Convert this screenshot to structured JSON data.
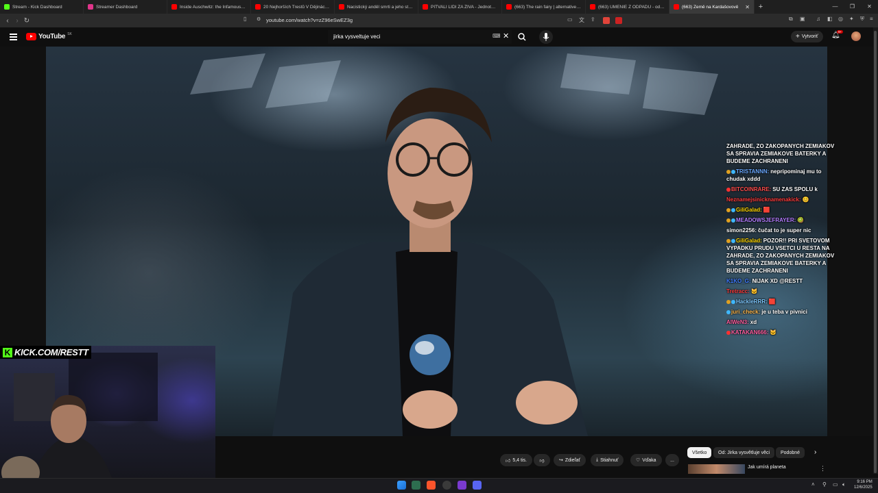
{
  "browser": {
    "tabs": [
      {
        "label": "Stream - Kick Dashboard",
        "color": "#53fc18",
        "active": false
      },
      {
        "label": "Streamer Dashboard",
        "color": "#e0358a",
        "active": false
      },
      {
        "label": "Inside Auschwitz: the Infamous Conc",
        "color": "#ff0000",
        "active": false
      },
      {
        "label": "20 Nejhorších Trestů V Dějinách Lidst",
        "color": "#ff0000",
        "active": false
      },
      {
        "label": "Nacistický anděl smrti a jeho strašlivé",
        "color": "#ff0000",
        "active": false
      },
      {
        "label": "PITVALI LIDI ZA ŽIVA - Jednotka 731",
        "color": "#ff0000",
        "active": false
      },
      {
        "label": "(663) The rain fairy | alternative playli",
        "color": "#ff0000",
        "active": false
      },
      {
        "label": "(663) UMENIE Z ODPADU - od opustn",
        "color": "#ff0000",
        "active": false
      },
      {
        "label": "(663) Země na Kardašovově",
        "color": "#ff0000",
        "active": true
      }
    ],
    "url": "youtube.com/watch?v=zZ96eSwEZ3g"
  },
  "youtube": {
    "logo": "YouTube",
    "country": "SK",
    "search_value": "jirka vysveltuje veci",
    "create_label": "Vytvoriť",
    "notif_count": "9+"
  },
  "overlay": {
    "kick_url": "KICK.COM/RESTT"
  },
  "chat": [
    {
      "user": "",
      "user_color": "#ffffff",
      "msg": "ZAHRADE, ZO ZAKOPANYCH ZEMIAKOV SA SPRAVIA ZEMIAKOVE BATERKY A BUDEME ZACHRANENI",
      "badges": []
    },
    {
      "user": "TRISTANNN:",
      "user_color": "#6aa8ff",
      "msg": "nepripominaj mu to chudak xddd",
      "badges": [
        "#e0a020",
        "#3fb8ff"
      ]
    },
    {
      "user": "BITCOINRARE:",
      "user_color": "#ff4d4d",
      "msg": "SU ZAS SPOLU k",
      "badges": [
        "#ff3030"
      ]
    },
    {
      "user": "Neznamejsinicknamenakick:",
      "user_color": "#ff3b3b",
      "msg": "😊",
      "badges": []
    },
    {
      "user": "GiliGalad:",
      "user_color": "#ffd700",
      "msg": "🟥",
      "badges": [
        "#e0a020",
        "#3fb8ff"
      ]
    },
    {
      "user": "MEADOWSJEFRAYER:",
      "user_color": "#b37cff",
      "msg": "🥝",
      "badges": [
        "#e0a020",
        "#3fb8ff"
      ]
    },
    {
      "user": "simon2256:",
      "user_color": "#ffffff",
      "msg": "čučat to je super nic",
      "badges": []
    },
    {
      "user": "GiliGalad:",
      "user_color": "#ffd700",
      "msg": "POZOR!! PRI SVETOVOM VYPADKU PRUDU VSETCI U RESTA NA ZAHRADE, ZO ZAKOPANYCH ZEMIAKOV SA SPRAVIA ZEMIAKOVE BATERKY A BUDEME ZACHRANENI",
      "badges": [
        "#e0a020",
        "#3fb8ff"
      ]
    },
    {
      "user": "K1KO_G:",
      "user_color": "#3f7bff",
      "msg": "NIJAK XD @RESTT",
      "badges": []
    },
    {
      "user": "Tretracc:",
      "user_color": "#ff3b3b",
      "msg": "🐱",
      "badges": []
    },
    {
      "user": "HackleRRR:",
      "user_color": "#7ec8ff",
      "msg": "🟥",
      "badges": [
        "#e0a020",
        "#3fb8ff"
      ]
    },
    {
      "user": "juri_check:",
      "user_color": "#ffb84d",
      "msg": "je u teba v pivnici",
      "badges": [
        "#3fb8ff"
      ]
    },
    {
      "user": "AlWeN3:",
      "user_color": "#ff5fa0",
      "msg": "xd",
      "badges": []
    },
    {
      "user": "KATAKAN666:",
      "user_color": "#ff5fa0",
      "msg": "🐱",
      "badges": [
        "#ff3030"
      ]
    }
  ],
  "actions": {
    "likes": "5,4 tis.",
    "share": "Zdieľať",
    "download": "Stiahnuť",
    "thanks": "Vďaka",
    "more": "..."
  },
  "chips": [
    {
      "label": "Všetko",
      "active": true
    },
    {
      "label": "Od: Jirka vysvětluje věci",
      "active": false
    },
    {
      "label": "Podobné",
      "active": false
    }
  ],
  "recommended": {
    "title": "Jak umírá planeta"
  },
  "taskbar": {
    "time": "9:16 PM",
    "date": "12/6/2025"
  },
  "colors": {
    "bg": "#0f0f0f",
    "kick_green": "#53fc18",
    "yt_red": "#ff0000"
  }
}
